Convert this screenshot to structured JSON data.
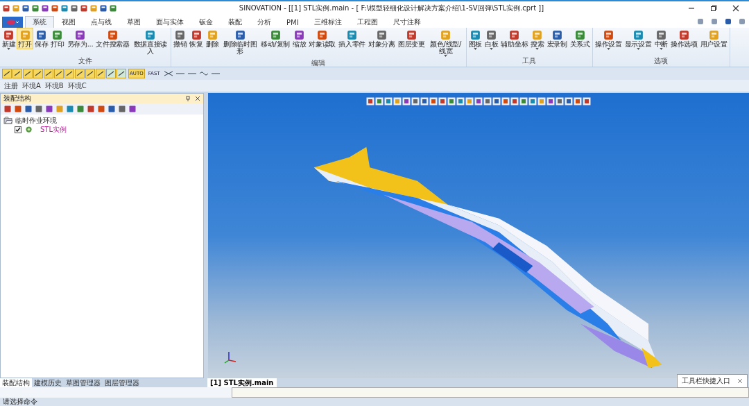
{
  "window": {
    "title": "SINOVATION - [[1] STL实例.main - [ F:\\模型轻细化设计解决方案介绍\\1-SV回弹\\STL实例.cprt ]]"
  },
  "tabs": [
    {
      "label": "系统",
      "selected": true
    },
    {
      "label": "视图",
      "selected": false
    },
    {
      "label": "点与线",
      "selected": false
    },
    {
      "label": "草图",
      "selected": false
    },
    {
      "label": "面与实体",
      "selected": false
    },
    {
      "label": "钣金",
      "selected": false
    },
    {
      "label": "装配",
      "selected": false
    },
    {
      "label": "分析",
      "selected": false
    },
    {
      "label": "PMI",
      "selected": false
    },
    {
      "label": "三维标注",
      "selected": false
    },
    {
      "label": "工程图",
      "selected": false
    },
    {
      "label": "尺寸注释",
      "selected": false
    }
  ],
  "ribbon": {
    "groups": [
      {
        "title": "文件",
        "buttons": [
          {
            "label": "新建",
            "dropdown": true,
            "highlighted": false
          },
          {
            "label": "打开",
            "dropdown": false,
            "highlighted": true
          },
          {
            "label": "保存",
            "dropdown": false,
            "highlighted": false
          },
          {
            "label": "打印",
            "dropdown": false,
            "highlighted": false
          },
          {
            "label": "另存为...",
            "dropdown": false,
            "highlighted": false
          },
          {
            "label": "文件搜索器",
            "dropdown": false,
            "highlighted": false
          },
          {
            "label": "数据直接读入",
            "dropdown": false,
            "highlighted": false
          }
        ]
      },
      {
        "title": "编辑",
        "buttons": [
          {
            "label": "撤销",
            "dropdown": false,
            "highlighted": false
          },
          {
            "label": "恢复",
            "dropdown": false,
            "highlighted": false
          },
          {
            "label": "删除",
            "dropdown": false,
            "highlighted": false
          },
          {
            "label": "删除临时图形",
            "dropdown": false,
            "highlighted": false
          },
          {
            "label": "移动/复制",
            "dropdown": false,
            "highlighted": false
          },
          {
            "label": "缩放",
            "dropdown": false,
            "highlighted": false
          },
          {
            "label": "对象读取",
            "dropdown": false,
            "highlighted": false
          },
          {
            "label": "插入零件",
            "dropdown": false,
            "highlighted": false
          },
          {
            "label": "对象分离",
            "dropdown": false,
            "highlighted": false
          },
          {
            "label": "图层变更",
            "dropdown": false,
            "highlighted": false
          },
          {
            "label": "颜色/线型/线宽",
            "dropdown": true,
            "highlighted": false
          }
        ]
      },
      {
        "title": "工具",
        "buttons": [
          {
            "label": "图板",
            "dropdown": true,
            "highlighted": false
          },
          {
            "label": "白板",
            "dropdown": true,
            "highlighted": false
          },
          {
            "label": "辅助坐标",
            "dropdown": false,
            "highlighted": false
          },
          {
            "label": "搜索",
            "dropdown": true,
            "highlighted": false
          },
          {
            "label": "宏录制",
            "dropdown": false,
            "highlighted": false
          },
          {
            "label": "关系式",
            "dropdown": false,
            "highlighted": false
          }
        ]
      },
      {
        "title": "选项",
        "buttons": [
          {
            "label": "操作设置",
            "dropdown": true,
            "highlighted": false
          },
          {
            "label": "显示设置",
            "dropdown": true,
            "highlighted": false
          },
          {
            "label": "中断",
            "dropdown": true,
            "highlighted": false
          },
          {
            "label": "操作选项",
            "dropdown": false,
            "highlighted": false
          },
          {
            "label": "用户设置",
            "dropdown": false,
            "highlighted": false
          }
        ]
      }
    ]
  },
  "mode_buttons": [
    {
      "label": "AUTO",
      "selected": true
    },
    {
      "label": "FAST",
      "selected": false
    }
  ],
  "environment_tabs": [
    "注册",
    "环境A",
    "环境B",
    "环境C"
  ],
  "assembly_panel": {
    "title": "装配结构",
    "tree": [
      {
        "label": "临时作业环境",
        "expanded": true,
        "children": [
          {
            "label": "STL实例",
            "checked": true
          }
        ]
      }
    ]
  },
  "viewport": {
    "tab": "[1] STL实例.main"
  },
  "bottom_tabs": [
    {
      "label": "装配结构",
      "selected": true
    },
    {
      "label": "建模历史",
      "selected": false
    },
    {
      "label": "草图管理器",
      "selected": false
    },
    {
      "label": "图层管理器",
      "selected": false
    }
  ],
  "tooltip": {
    "text": "工具栏快捷入口"
  },
  "status_bar": {
    "prompt": "请选择命令"
  }
}
